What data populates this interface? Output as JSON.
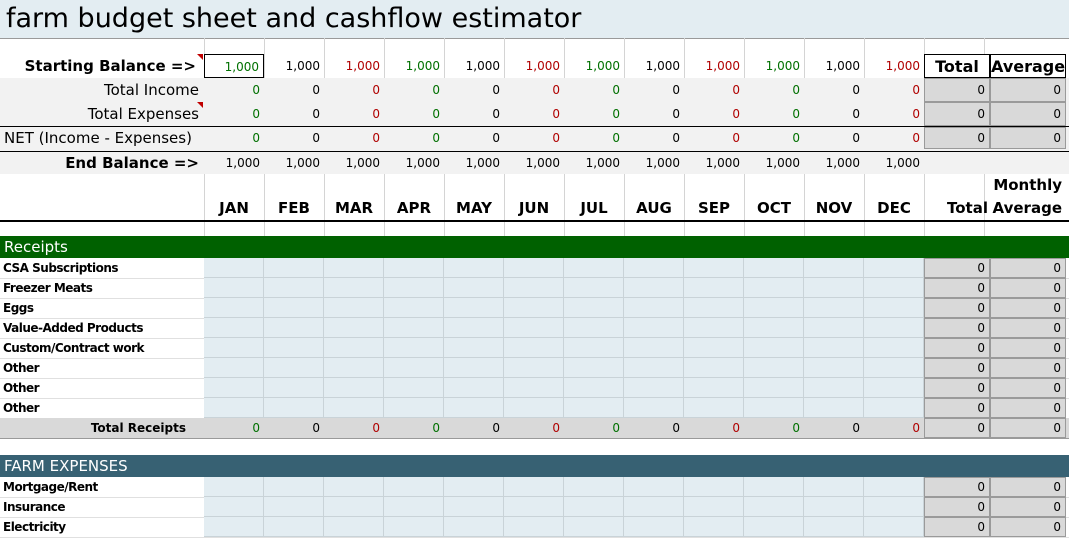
{
  "title": "farm budget sheet and cashflow estimator",
  "summary": {
    "starting_label": "Starting Balance =>",
    "starting_values": [
      "1,000",
      "1,000",
      "1,000",
      "1,000",
      "1,000",
      "1,000",
      "1,000",
      "1,000",
      "1,000",
      "1,000",
      "1,000",
      "1,000"
    ],
    "total_header": "Total",
    "average_header": "Average",
    "income_label": "Total Income",
    "income_values": [
      "0",
      "0",
      "0",
      "0",
      "0",
      "0",
      "0",
      "0",
      "0",
      "0",
      "0",
      "0"
    ],
    "income_total": "0",
    "income_avg": "0",
    "expenses_label": "Total Expenses",
    "expenses_values": [
      "0",
      "0",
      "0",
      "0",
      "0",
      "0",
      "0",
      "0",
      "0",
      "0",
      "0",
      "0"
    ],
    "expenses_total": "0",
    "expenses_avg": "0",
    "net_label": "NET (Income - Expenses)",
    "net_values": [
      "0",
      "0",
      "0",
      "0",
      "0",
      "0",
      "0",
      "0",
      "0",
      "0",
      "0",
      "0"
    ],
    "net_total": "0",
    "net_avg": "0",
    "end_label": "End Balance =>",
    "end_values": [
      "1,000",
      "1,000",
      "1,000",
      "1,000",
      "1,000",
      "1,000",
      "1,000",
      "1,000",
      "1,000",
      "1,000",
      "1,000",
      "1,000"
    ]
  },
  "months": [
    "JAN",
    "FEB",
    "MAR",
    "APR",
    "MAY",
    "JUN",
    "JUL",
    "AUG",
    "SEP",
    "OCT",
    "NOV",
    "DEC"
  ],
  "col_total": "Total",
  "col_monthly": "Monthly",
  "col_average": "Average",
  "receipts": {
    "header": "Receipts",
    "header_color": "#006100",
    "items": [
      {
        "label": "CSA Subscriptions",
        "total": "0",
        "avg": "0"
      },
      {
        "label": "Freezer Meats",
        "total": "0",
        "avg": "0"
      },
      {
        "label": "Eggs",
        "total": "0",
        "avg": "0"
      },
      {
        "label": "Value-Added Products",
        "total": "0",
        "avg": "0"
      },
      {
        "label": "Custom/Contract work",
        "total": "0",
        "avg": "0"
      },
      {
        "label": "Other",
        "total": "0",
        "avg": "0"
      },
      {
        "label": "Other",
        "total": "0",
        "avg": "0"
      },
      {
        "label": "Other",
        "total": "0",
        "avg": "0"
      }
    ],
    "total_label": "Total Receipts",
    "total_values": [
      "0",
      "0",
      "0",
      "0",
      "0",
      "0",
      "0",
      "0",
      "0",
      "0",
      "0",
      "0"
    ],
    "total_total": "0",
    "total_avg": "0"
  },
  "expenses": {
    "header": "FARM  EXPENSES",
    "header_color": "#376173",
    "items": [
      {
        "label": "Mortgage/Rent",
        "total": "0",
        "avg": "0"
      },
      {
        "label": "Insurance",
        "total": "0",
        "avg": "0"
      },
      {
        "label": "Electricity",
        "total": "0",
        "avg": "0"
      }
    ]
  },
  "month_colors": [
    "#007000",
    "#000000",
    "#b00000",
    "#007000",
    "#000000",
    "#b00000",
    "#007000",
    "#000000",
    "#b00000",
    "#007000",
    "#000000",
    "#b00000"
  ]
}
